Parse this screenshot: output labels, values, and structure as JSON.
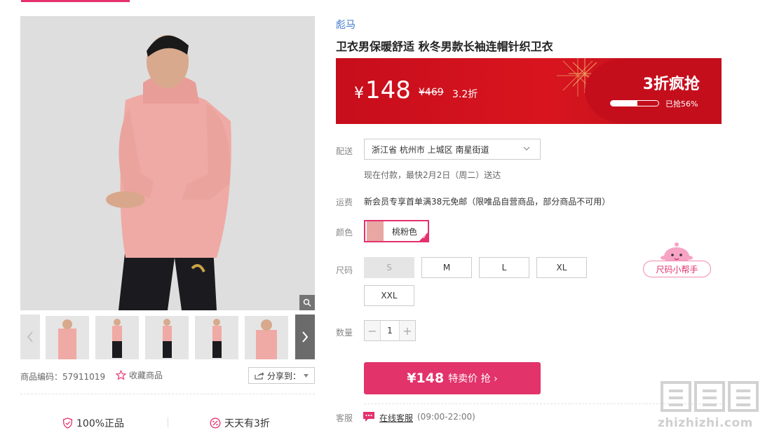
{
  "brand": "彪马",
  "product_title": "卫衣男保暖舒适 秋冬男款长袖连帽针织卫衣",
  "price_banner": {
    "price_symbol": "¥",
    "price": "148",
    "original_price": "¥469",
    "discount": "3.2折",
    "promo_title": "3折疯抢",
    "progress_percent": 56,
    "progress_label": "已抢56%"
  },
  "delivery": {
    "label": "配送",
    "address": "浙江省 杭州市 上城区 南星街道",
    "note": "现在付款，最快2月2日（周二）送达"
  },
  "shipping": {
    "label": "运费",
    "text": "新会员专享首单满38元免邮（限唯品自营商品，部分商品不可用）"
  },
  "color": {
    "label": "颜色",
    "selected": "桃粉色"
  },
  "size": {
    "label": "尺码",
    "options": [
      "S",
      "M",
      "L",
      "XL",
      "XXL"
    ],
    "disabled": [
      "S"
    ],
    "helper": "尺码小帮手"
  },
  "quantity": {
    "label": "数量",
    "value": "1",
    "minus": "−",
    "plus": "+"
  },
  "buy_button": {
    "price": "¥148",
    "label": "特卖价 抢 ›"
  },
  "service": {
    "label": "客服",
    "link": "在线客服",
    "hours": "(09:00-22:00)"
  },
  "gallery": {
    "sku": "商品编码：57911019",
    "favorite": "收藏商品",
    "share": "分享到："
  },
  "guarantees": [
    "100%正品",
    "天天有3折"
  ],
  "watermark": {
    "logo": "值值值",
    "site": "zhizhizhi.com"
  },
  "colors": {
    "accent": "#e2336a",
    "banner_red": "#d8151f",
    "brand_blue": "#3b74c8",
    "product_pink": "#e8a7a3"
  }
}
